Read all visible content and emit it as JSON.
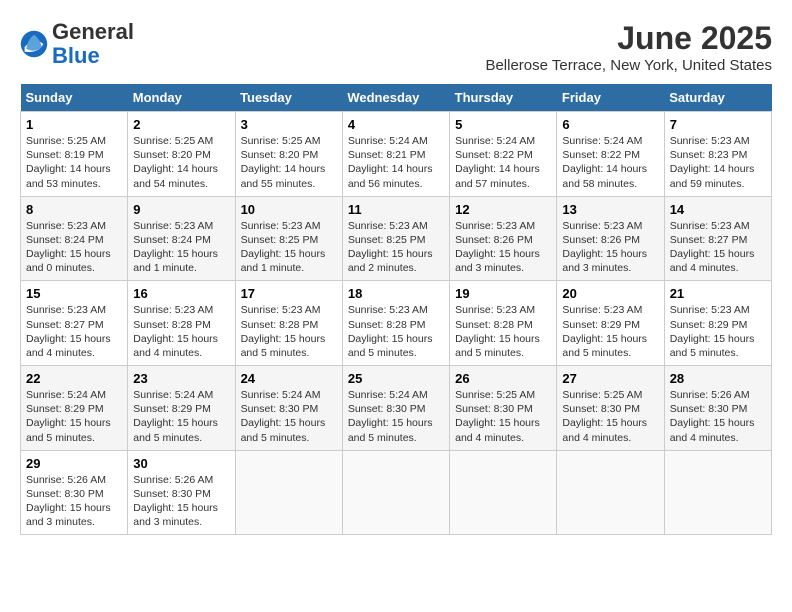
{
  "header": {
    "logo_line1": "General",
    "logo_line2": "Blue",
    "month": "June 2025",
    "location": "Bellerose Terrace, New York, United States"
  },
  "columns": [
    "Sunday",
    "Monday",
    "Tuesday",
    "Wednesday",
    "Thursday",
    "Friday",
    "Saturday"
  ],
  "weeks": [
    [
      {
        "day": "1",
        "info": "Sunrise: 5:25 AM\nSunset: 8:19 PM\nDaylight: 14 hours\nand 53 minutes."
      },
      {
        "day": "2",
        "info": "Sunrise: 5:25 AM\nSunset: 8:20 PM\nDaylight: 14 hours\nand 54 minutes."
      },
      {
        "day": "3",
        "info": "Sunrise: 5:25 AM\nSunset: 8:20 PM\nDaylight: 14 hours\nand 55 minutes."
      },
      {
        "day": "4",
        "info": "Sunrise: 5:24 AM\nSunset: 8:21 PM\nDaylight: 14 hours\nand 56 minutes."
      },
      {
        "day": "5",
        "info": "Sunrise: 5:24 AM\nSunset: 8:22 PM\nDaylight: 14 hours\nand 57 minutes."
      },
      {
        "day": "6",
        "info": "Sunrise: 5:24 AM\nSunset: 8:22 PM\nDaylight: 14 hours\nand 58 minutes."
      },
      {
        "day": "7",
        "info": "Sunrise: 5:23 AM\nSunset: 8:23 PM\nDaylight: 14 hours\nand 59 minutes."
      }
    ],
    [
      {
        "day": "8",
        "info": "Sunrise: 5:23 AM\nSunset: 8:24 PM\nDaylight: 15 hours\nand 0 minutes."
      },
      {
        "day": "9",
        "info": "Sunrise: 5:23 AM\nSunset: 8:24 PM\nDaylight: 15 hours\nand 1 minute."
      },
      {
        "day": "10",
        "info": "Sunrise: 5:23 AM\nSunset: 8:25 PM\nDaylight: 15 hours\nand 1 minute."
      },
      {
        "day": "11",
        "info": "Sunrise: 5:23 AM\nSunset: 8:25 PM\nDaylight: 15 hours\nand 2 minutes."
      },
      {
        "day": "12",
        "info": "Sunrise: 5:23 AM\nSunset: 8:26 PM\nDaylight: 15 hours\nand 3 minutes."
      },
      {
        "day": "13",
        "info": "Sunrise: 5:23 AM\nSunset: 8:26 PM\nDaylight: 15 hours\nand 3 minutes."
      },
      {
        "day": "14",
        "info": "Sunrise: 5:23 AM\nSunset: 8:27 PM\nDaylight: 15 hours\nand 4 minutes."
      }
    ],
    [
      {
        "day": "15",
        "info": "Sunrise: 5:23 AM\nSunset: 8:27 PM\nDaylight: 15 hours\nand 4 minutes."
      },
      {
        "day": "16",
        "info": "Sunrise: 5:23 AM\nSunset: 8:28 PM\nDaylight: 15 hours\nand 4 minutes."
      },
      {
        "day": "17",
        "info": "Sunrise: 5:23 AM\nSunset: 8:28 PM\nDaylight: 15 hours\nand 5 minutes."
      },
      {
        "day": "18",
        "info": "Sunrise: 5:23 AM\nSunset: 8:28 PM\nDaylight: 15 hours\nand 5 minutes."
      },
      {
        "day": "19",
        "info": "Sunrise: 5:23 AM\nSunset: 8:28 PM\nDaylight: 15 hours\nand 5 minutes."
      },
      {
        "day": "20",
        "info": "Sunrise: 5:23 AM\nSunset: 8:29 PM\nDaylight: 15 hours\nand 5 minutes."
      },
      {
        "day": "21",
        "info": "Sunrise: 5:23 AM\nSunset: 8:29 PM\nDaylight: 15 hours\nand 5 minutes."
      }
    ],
    [
      {
        "day": "22",
        "info": "Sunrise: 5:24 AM\nSunset: 8:29 PM\nDaylight: 15 hours\nand 5 minutes."
      },
      {
        "day": "23",
        "info": "Sunrise: 5:24 AM\nSunset: 8:29 PM\nDaylight: 15 hours\nand 5 minutes."
      },
      {
        "day": "24",
        "info": "Sunrise: 5:24 AM\nSunset: 8:30 PM\nDaylight: 15 hours\nand 5 minutes."
      },
      {
        "day": "25",
        "info": "Sunrise: 5:24 AM\nSunset: 8:30 PM\nDaylight: 15 hours\nand 5 minutes."
      },
      {
        "day": "26",
        "info": "Sunrise: 5:25 AM\nSunset: 8:30 PM\nDaylight: 15 hours\nand 4 minutes."
      },
      {
        "day": "27",
        "info": "Sunrise: 5:25 AM\nSunset: 8:30 PM\nDaylight: 15 hours\nand 4 minutes."
      },
      {
        "day": "28",
        "info": "Sunrise: 5:26 AM\nSunset: 8:30 PM\nDaylight: 15 hours\nand 4 minutes."
      }
    ],
    [
      {
        "day": "29",
        "info": "Sunrise: 5:26 AM\nSunset: 8:30 PM\nDaylight: 15 hours\nand 3 minutes."
      },
      {
        "day": "30",
        "info": "Sunrise: 5:26 AM\nSunset: 8:30 PM\nDaylight: 15 hours\nand 3 minutes."
      },
      {
        "day": "",
        "info": ""
      },
      {
        "day": "",
        "info": ""
      },
      {
        "day": "",
        "info": ""
      },
      {
        "day": "",
        "info": ""
      },
      {
        "day": "",
        "info": ""
      }
    ]
  ]
}
